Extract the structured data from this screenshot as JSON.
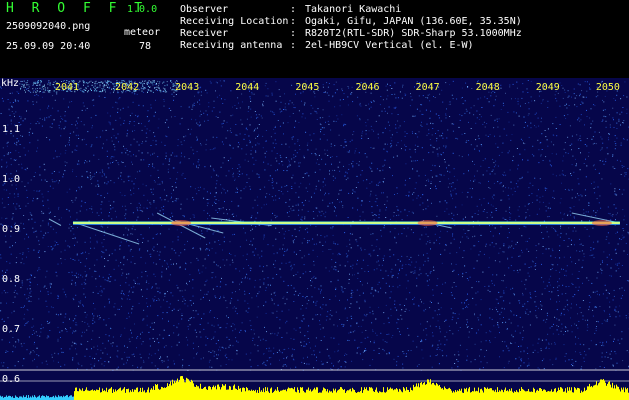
{
  "header": {
    "logo": "H R O F F T",
    "version": "1.0.0",
    "filename": "2509092040.png",
    "timestamp": "25.09.09 20:40",
    "meteor_label": "meteor",
    "meteor_count": "78",
    "info": [
      {
        "label": "Observer",
        "value": "Takanori Kawachi"
      },
      {
        "label": "Receiving Location",
        "value": "Ogaki, Gifu, JAPAN (136.60E, 35.35N)"
      },
      {
        "label": "Receiver",
        "value": "R820T2(RTL-SDR) SDR-Sharp 53.1000MHz"
      },
      {
        "label": "Receiving antenna",
        "value": "2el-HB9CV Vertical (el. E-W)"
      }
    ],
    "colors": {
      "green": "#33ff33",
      "white": "#ffffff",
      "yellow": "#ffff44",
      "background": "#000000"
    }
  },
  "chart_data": {
    "type": "heatmap",
    "title": "",
    "xlabel": "",
    "ylabel": "kHz",
    "x_ticks": [
      "2041",
      "2042",
      "2043",
      "2044",
      "2045",
      "2046",
      "2047",
      "2048",
      "2049",
      "2050"
    ],
    "y_ticks": [
      "1.1",
      "1.0",
      "0.9",
      "0.8",
      "0.7",
      "0.6"
    ],
    "ylim": [
      0.6,
      1.2
    ],
    "xlim": [
      2040.7,
      2050.2
    ],
    "grid": false,
    "carrier": {
      "frequency_khz": 0.91,
      "start": 2041.1,
      "end": 2050.2,
      "color": "#ccff88"
    },
    "meteor_traces": [
      {
        "t1": 2041.1,
        "f1": 0.912,
        "t2": 2042.2,
        "f2": 0.868
      },
      {
        "t1": 2042.5,
        "f1": 0.93,
        "t2": 2043.3,
        "f2": 0.88
      },
      {
        "t1": 2042.8,
        "f1": 0.915,
        "t2": 2043.6,
        "f2": 0.89
      },
      {
        "t1": 2043.4,
        "f1": 0.92,
        "t2": 2044.4,
        "f2": 0.905
      },
      {
        "t1": 2046.9,
        "f1": 0.913,
        "t2": 2047.4,
        "f2": 0.9
      },
      {
        "t1": 2049.4,
        "f1": 0.93,
        "t2": 2050.2,
        "f2": 0.91
      },
      {
        "t1": 2040.7,
        "f1": 0.918,
        "t2": 2040.9,
        "f2": 0.905
      }
    ],
    "bursts": [
      {
        "t": 2042.9,
        "f": 0.91
      },
      {
        "t": 2047.0,
        "f": 0.91
      },
      {
        "t": 2049.9,
        "f": 0.91
      }
    ],
    "colors": {
      "background": "#06064a",
      "noise": "#2e6cff",
      "tick_text": "#ffff44",
      "axis_text": "#ffffff",
      "level_bars": "#ffff00",
      "level_pre": "#33ccff",
      "reference_line": "#ffffff"
    }
  }
}
